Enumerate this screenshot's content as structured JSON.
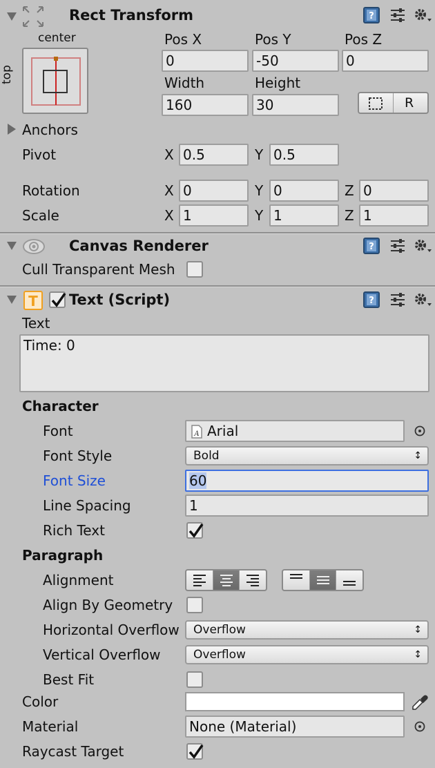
{
  "rect_transform": {
    "title": "Rect Transform",
    "anchor_h_label": "center",
    "anchor_v_label": "top",
    "pos_x_label": "Pos X",
    "pos_y_label": "Pos Y",
    "pos_z_label": "Pos Z",
    "pos_x": "0",
    "pos_y": "-50",
    "pos_z": "0",
    "width_label": "Width",
    "height_label": "Height",
    "width": "160",
    "height": "30",
    "raw_button_label": "R",
    "anchors_label": "Anchors",
    "pivot_label": "Pivot",
    "pivot_x": "0.5",
    "pivot_y": "0.5",
    "rotation_label": "Rotation",
    "rotation_x": "0",
    "rotation_y": "0",
    "rotation_z": "0",
    "scale_label": "Scale",
    "scale_x": "1",
    "scale_y": "1",
    "scale_z": "1",
    "axis_x": "X",
    "axis_y": "Y",
    "axis_z": "Z"
  },
  "canvas_renderer": {
    "title": "Canvas Renderer",
    "cull_label": "Cull Transparent Mesh",
    "cull_checked": false
  },
  "text_script": {
    "title": "Text (Script)",
    "enabled": true,
    "text_label": "Text",
    "text_value": "Time: 0",
    "character_label": "Character",
    "font_label": "Font",
    "font_value": "Arial",
    "font_style_label": "Font Style",
    "font_style_value": "Bold",
    "font_size_label": "Font Size",
    "font_size_value": "60",
    "line_spacing_label": "Line Spacing",
    "line_spacing_value": "1",
    "rich_text_label": "Rich Text",
    "rich_text_checked": true,
    "paragraph_label": "Paragraph",
    "alignment_label": "Alignment",
    "align_by_geometry_label": "Align By Geometry",
    "align_by_geometry_checked": false,
    "horizontal_overflow_label": "Horizontal Overflow",
    "horizontal_overflow_value": "Overflow",
    "vertical_overflow_label": "Vertical Overflow",
    "vertical_overflow_value": "Overflow",
    "best_fit_label": "Best Fit",
    "best_fit_checked": false,
    "color_label": "Color",
    "color_value": "#ffffff",
    "material_label": "Material",
    "material_value": "None (Material)",
    "raycast_label": "Raycast Target",
    "raycast_checked": true
  },
  "colors": {
    "panel_bg": "#c2c2c2",
    "focused_label": "#1f4fd6",
    "focus_border": "#3d6fe0",
    "header_icon_blue": "#3c6fa8",
    "text_icon_orange": "#f0a020"
  },
  "icons": [
    "rect-transform-icon",
    "help-icon",
    "presets-icon",
    "gear-icon",
    "eye-icon",
    "text-component-icon",
    "font-asset-icon",
    "object-picker-icon",
    "eyedropper-icon",
    "blueprint-icon"
  ]
}
